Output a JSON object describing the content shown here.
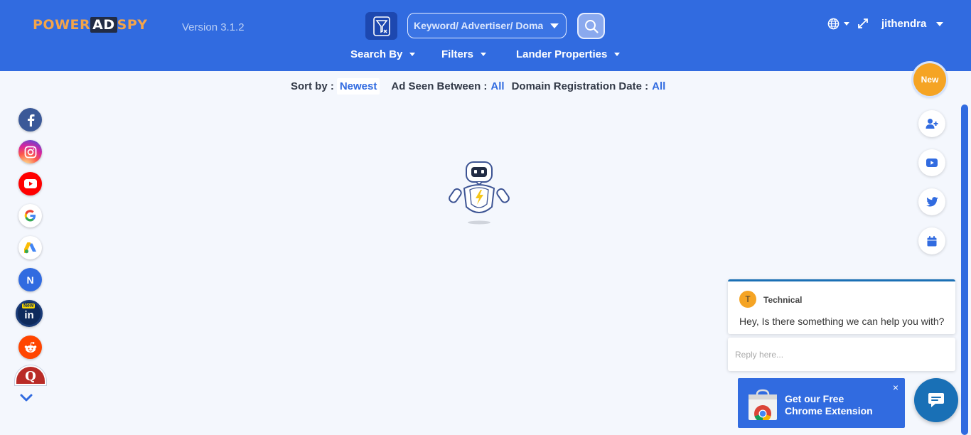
{
  "header": {
    "logo": {
      "part1": "POWER",
      "part2": "AD",
      "part3": "SPY"
    },
    "version": "Version 3.1.2",
    "search": {
      "placeholder": "Keyword/ Advertiser/ Domain",
      "value": ""
    },
    "nav": [
      {
        "label": "Search By"
      },
      {
        "label": "Filters"
      },
      {
        "label": "Lander Properties"
      }
    ],
    "username": "jithendra"
  },
  "sortbar": {
    "sort_label": "Sort by :",
    "sort_value": "Newest",
    "seen_label": "Ad Seen Between :",
    "seen_value": "All",
    "domain_label": "Domain Registration Date :",
    "domain_value": "All"
  },
  "sidebar": {
    "items": [
      {
        "name": "facebook",
        "icon": "facebook-icon",
        "color": "#3b5998"
      },
      {
        "name": "instagram",
        "icon": "instagram-icon",
        "color": "#d6249f"
      },
      {
        "name": "youtube",
        "icon": "youtube-icon",
        "color": "#ff0000"
      },
      {
        "name": "google",
        "icon": "google-icon",
        "color": "#ffffff"
      },
      {
        "name": "google-ads",
        "icon": "google-ads-icon",
        "color": "#ffffff"
      },
      {
        "name": "native",
        "icon": "native-icon",
        "color": "#316be0",
        "text": "N"
      },
      {
        "name": "linkedin",
        "icon": "linkedin-icon",
        "color": "#0e2a5c",
        "badge": "New",
        "text": "in"
      },
      {
        "name": "reddit",
        "icon": "reddit-icon",
        "color": "#ff4500"
      },
      {
        "name": "quora",
        "icon": "quora-icon",
        "color": "#b92b27",
        "text": "Q"
      }
    ]
  },
  "right_actions": {
    "new_badge": "New",
    "buttons": [
      {
        "name": "add-user",
        "icon": "add-user-icon"
      },
      {
        "name": "youtube",
        "icon": "youtube-icon"
      },
      {
        "name": "twitter",
        "icon": "twitter-icon"
      },
      {
        "name": "calendar",
        "icon": "calendar-icon"
      }
    ]
  },
  "chat": {
    "agent_initial": "T",
    "agent_name": "Technical",
    "message": "Hey, Is there something we can help you with?",
    "reply_placeholder": "Reply here..."
  },
  "extension_banner": {
    "line1": "Get our Free",
    "line2": "Chrome Extension",
    "close": "×"
  },
  "colors": {
    "primary": "#316be0",
    "accent_orange": "#f5a424",
    "chat_blue": "#1970b6"
  }
}
